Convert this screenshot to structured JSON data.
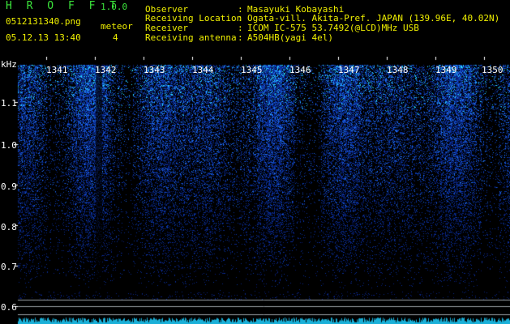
{
  "header": {
    "app_title": "H R O F F T",
    "app_version": "1.0.0",
    "file_name": "0512131340.png",
    "mode_label": "meteor",
    "timestamp": "05.12.13 13:40",
    "meteor_count": "4"
  },
  "info": [
    {
      "key": "Observer",
      "value": "Masayuki Kobayashi"
    },
    {
      "key": "Receiving Location",
      "value": "Ogata-vill. Akita-Pref. JAPAN (139.96E, 40.02N)"
    },
    {
      "key": "Receiver",
      "value": "ICOM IC-575 53.7492(@LCD)MHz USB"
    },
    {
      "key": "Receiving antenna",
      "value": "A504HB(yagi 4el)"
    }
  ],
  "spectrogram": {
    "axis_unit": "kHz",
    "y_ticks": [
      "1.1",
      "1.0",
      "0.9",
      "0.8",
      "0.7",
      "0.6"
    ],
    "minute_labels": [
      "1341",
      "1342",
      "1343",
      "1344",
      "1345",
      "1346",
      "1347",
      "1348",
      "1349",
      "1350"
    ],
    "colors": {
      "background": "#000000",
      "signal_low": "#0a1a8c",
      "signal_high": "#2ee8ff",
      "text": "#ffffff",
      "header_green": "#3ce63c",
      "header_yellow": "#f0f000"
    }
  }
}
